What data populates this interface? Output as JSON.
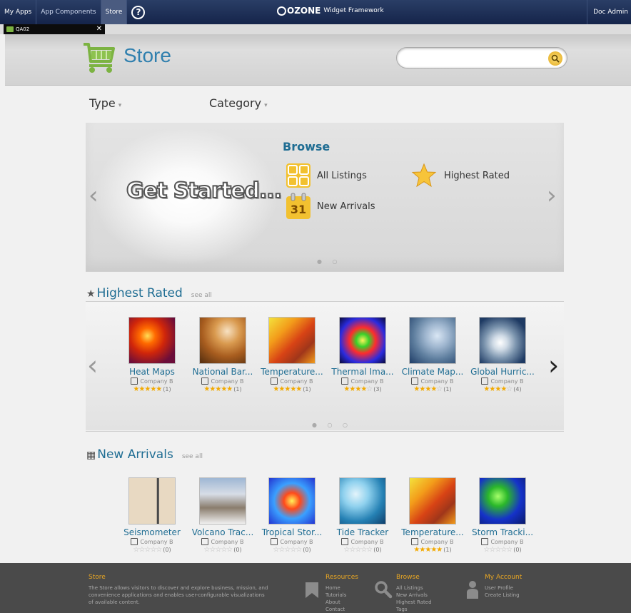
{
  "topbar": {
    "nav": [
      "My Apps",
      "App Components",
      "Store"
    ],
    "help": "?",
    "brand_name": "OZONE",
    "brand_suffix": "Widget Framework",
    "user": "Doc Admin"
  },
  "tab": {
    "label": "QA02",
    "close": "✕"
  },
  "header": {
    "title": "Store",
    "search_value": ""
  },
  "filters": {
    "type": "Type",
    "category": "Category",
    "caret": "▾"
  },
  "carousel": {
    "headline": "Get Started...",
    "browse_title": "Browse",
    "items": [
      "All Listings",
      "Highest Rated",
      "New Arrivals"
    ],
    "calendar_day": "31",
    "prev": "‹",
    "next": "›",
    "dots": "● ○"
  },
  "highest_rated": {
    "title": "Highest Rated",
    "see_all": "see all",
    "dots": "● ○ ○",
    "prev": "‹",
    "next": "›",
    "cards": [
      {
        "name": "Heat Maps",
        "company": "Company B",
        "rating": 5,
        "count": "(1)"
      },
      {
        "name": "National Bar...",
        "company": "Company B",
        "rating": 5,
        "count": "(1)"
      },
      {
        "name": "Temperature...",
        "company": "Company B",
        "rating": 5,
        "count": "(1)"
      },
      {
        "name": "Thermal Ima...",
        "company": "Company B",
        "rating": 4.5,
        "count": "(3)"
      },
      {
        "name": "Climate Map...",
        "company": "Company B",
        "rating": 4,
        "count": "(1)"
      },
      {
        "name": "Global Hurric...",
        "company": "Company B",
        "rating": 4,
        "count": "(4)"
      }
    ]
  },
  "new_arrivals": {
    "title": "New Arrivals",
    "see_all": "see all",
    "cards": [
      {
        "name": "Seismometer",
        "company": "Company B",
        "rating": 0,
        "count": "(0)"
      },
      {
        "name": "Volcano Trac...",
        "company": "Company B",
        "rating": 0,
        "count": "(0)"
      },
      {
        "name": "Tropical Stor...",
        "company": "Company B",
        "rating": 0,
        "count": "(0)"
      },
      {
        "name": "Tide Tracker",
        "company": "Company B",
        "rating": 0,
        "count": "(0)"
      },
      {
        "name": "Temperature...",
        "company": "Company B",
        "rating": 5,
        "count": "(1)"
      },
      {
        "name": "Storm Tracki...",
        "company": "Company B",
        "rating": 0,
        "count": "(0)"
      }
    ]
  },
  "footer": {
    "store_title": "Store",
    "store_text": [
      "The Store allows visitors to discover and explore business, mission, and",
      "convenience applications and enables user-configurable visualizations",
      "of available content."
    ],
    "resources_title": "Resources",
    "resources": [
      "Home",
      "Tutorials",
      "About",
      "Contact"
    ],
    "browse_title": "Browse",
    "browse": [
      "All Listings",
      "New Arrivals",
      "Highest Rated",
      "Tags"
    ],
    "account_title": "My Account",
    "account": [
      "User Profile",
      "Create Listing"
    ]
  },
  "colors": {
    "accent": "#1f6d93",
    "star": "#f2a900",
    "footer_title": "#e8a623"
  }
}
